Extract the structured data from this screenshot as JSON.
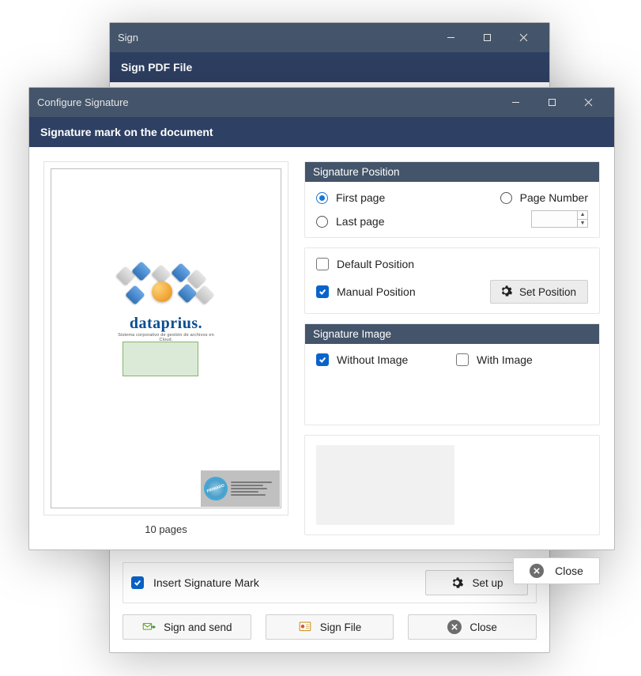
{
  "bg_window": {
    "title": "Sign",
    "subheader": "Sign PDF File",
    "insert_mark_label": "Insert Signature Mark",
    "btn_setup": "Set up",
    "btn_sign_send": "Sign and send",
    "btn_sign_file": "Sign File",
    "btn_close": "Close"
  },
  "window": {
    "title": "Configure Signature",
    "subheader": "Signature mark on the document"
  },
  "preview": {
    "pages_label": "10 pages",
    "logo_text": "dataprius.",
    "logo_tag": "Sistema corporativo de gestión de archivos en Cloud.",
    "stamp_text": "FIRMADO"
  },
  "position": {
    "header": "Signature Position",
    "opt_first": "First page",
    "opt_last": "Last page",
    "opt_page_number": "Page Number",
    "page_number_value": "",
    "chk_default": "Default Position",
    "chk_manual": "Manual Position",
    "btn_setpos": "Set Position"
  },
  "image": {
    "header": "Signature Image",
    "chk_without": "Without Image",
    "chk_with": "With Image"
  },
  "btn_close": "Close"
}
